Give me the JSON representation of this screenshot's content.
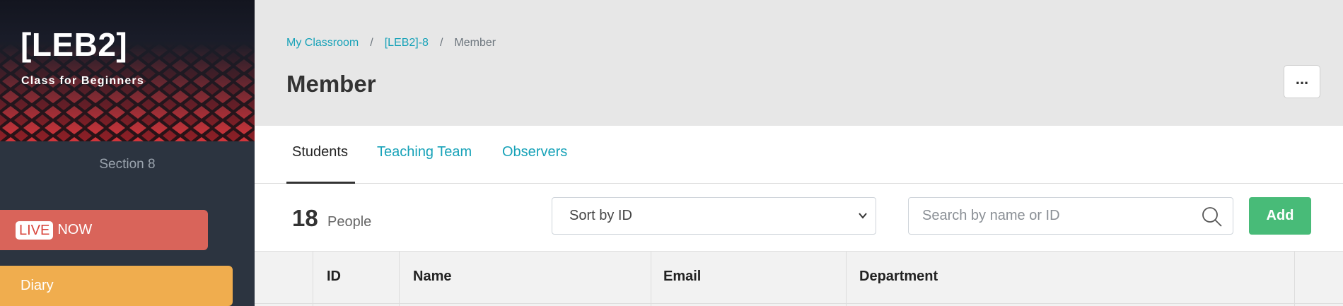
{
  "sidebar": {
    "course_code": "[LEB2]",
    "course_subtitle": "Class for Beginners",
    "section": "Section 8",
    "live_tag": "LIVE",
    "live_suffix": "NOW",
    "diary_label": "Diary",
    "colors": {
      "live": "#d9645a",
      "diary": "#f0ad4e"
    }
  },
  "header": {
    "breadcrumb": [
      {
        "label": "My Classroom"
      },
      {
        "label": "[LEB2]-8"
      },
      {
        "label": "Member"
      }
    ],
    "breadcrumb_separator": "/",
    "title": "Member",
    "more_label": "..."
  },
  "tabs": [
    {
      "label": "Students",
      "active": true
    },
    {
      "label": "Teaching Team",
      "active": false
    },
    {
      "label": "Observers",
      "active": false
    }
  ],
  "toolbar": {
    "count": "18",
    "count_label": "People",
    "sort_selected": "Sort by ID",
    "search_placeholder": "Search by name or ID",
    "add_label": "Add",
    "accent_color": "#17a2b8",
    "add_color": "#48bb78"
  },
  "table": {
    "columns": [
      "",
      "ID",
      "Name",
      "Email",
      "Department",
      ""
    ]
  }
}
